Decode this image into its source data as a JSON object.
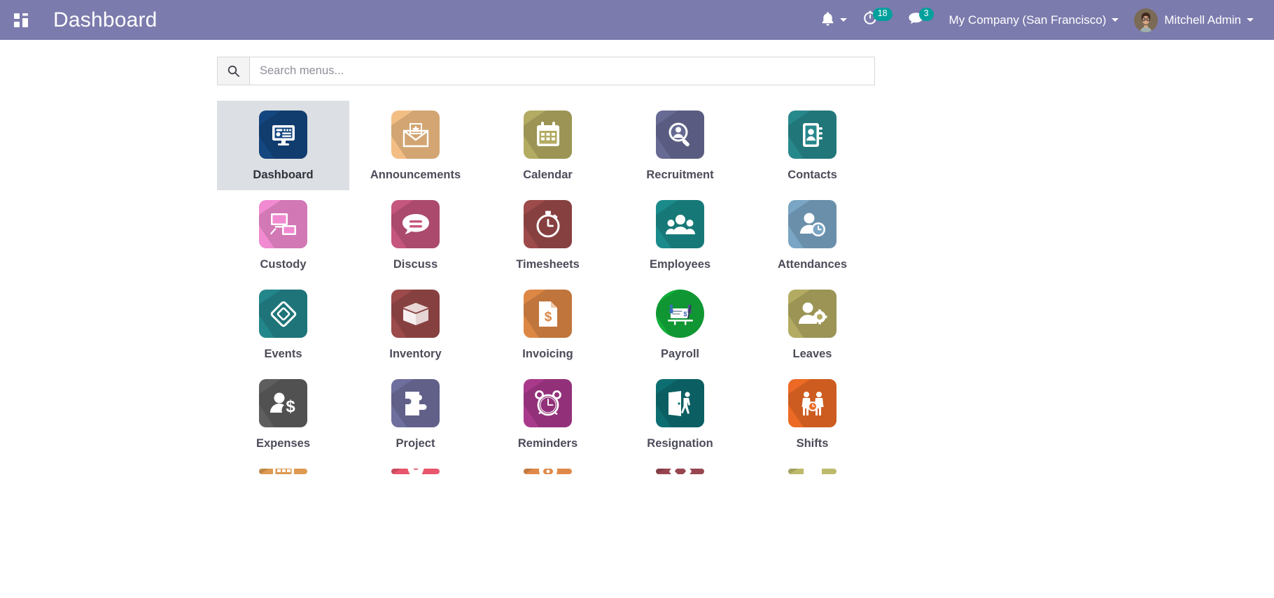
{
  "navbar": {
    "apps_icon": "apps-grid-icon",
    "title": "Dashboard",
    "activities_icon": "bell-icon",
    "timer_icon": "timer-clock-icon",
    "timer_count": "18",
    "messages_icon": "chat-bubble-icon",
    "messages_count": "3",
    "company": "My Company (San Francisco)",
    "user": "Mitchell Admin",
    "accent": "#7c7bad",
    "badge_color": "#00a09d"
  },
  "search": {
    "icon": "search-icon",
    "placeholder": "Search menus...",
    "value": ""
  },
  "apps": {
    "rows": [
      [
        {
          "label": "Dashboard",
          "icon": "monitor-dashboard-icon",
          "color": "#14467f",
          "selected": true
        },
        {
          "label": "Announcements",
          "icon": "envelope-star-icon",
          "color": "#f2be84",
          "selected": false
        },
        {
          "label": "Calendar",
          "icon": "calendar-icon",
          "color": "#b3ab62",
          "selected": false
        },
        {
          "label": "Recruitment",
          "icon": "magnifier-person-icon",
          "color": "#676a93",
          "selected": false
        },
        {
          "label": "Contacts",
          "icon": "address-book-icon",
          "color": "#27888c",
          "selected": false
        }
      ],
      [
        {
          "label": "Custody",
          "icon": "devices-icon",
          "color": "#f18ad0",
          "selected": false
        },
        {
          "label": "Discuss",
          "icon": "speech-bubble-icon",
          "color": "#c5567e",
          "selected": false
        },
        {
          "label": "Timesheets",
          "icon": "stopwatch-icon",
          "color": "#9c4a4a",
          "selected": false
        },
        {
          "label": "Employees",
          "icon": "people-group-icon",
          "color": "#1b8a8a",
          "selected": false
        },
        {
          "label": "Attendances",
          "icon": "person-clock-icon",
          "color": "#7aa5c4",
          "selected": false
        }
      ],
      [
        {
          "label": "Events",
          "icon": "diamond-icon",
          "color": "#23868a",
          "selected": false
        },
        {
          "label": "Inventory",
          "icon": "box-icon",
          "color": "#9c4a4a",
          "selected": false
        },
        {
          "label": "Invoicing",
          "icon": "invoice-doc-icon",
          "color": "#dd8745",
          "selected": false
        },
        {
          "label": "Payroll",
          "icon": "paycheck-icon",
          "color": "#13ad3a",
          "selected": false,
          "circle": true
        },
        {
          "label": "Leaves",
          "icon": "person-gear-icon",
          "color": "#b3ab62",
          "selected": false
        }
      ],
      [
        {
          "label": "Expenses",
          "icon": "person-dollar-icon",
          "color": "#5e5e5e",
          "selected": false
        },
        {
          "label": "Project",
          "icon": "puzzle-piece-icon",
          "color": "#6f6f9e",
          "selected": false
        },
        {
          "label": "Reminders",
          "icon": "alarm-clock-icon",
          "color": "#a8398b",
          "selected": false
        },
        {
          "label": "Resignation",
          "icon": "door-exit-icon",
          "color": "#0d6e71",
          "selected": false
        },
        {
          "label": "Shifts",
          "icon": "two-people-icon",
          "color": "#ec6a25",
          "selected": false
        }
      ],
      [
        {
          "label": "",
          "icon": "calendar-orange-icon",
          "color": "#dd9a52",
          "selected": false
        },
        {
          "label": "",
          "icon": "pin-pink-icon",
          "color": "#e8566d",
          "selected": false
        },
        {
          "label": "",
          "icon": "orange-app-icon",
          "color": "#e08a4a",
          "selected": false
        },
        {
          "label": "",
          "icon": "maroon-app-icon",
          "color": "#974650",
          "selected": false
        },
        {
          "label": "",
          "icon": "olive-app-icon",
          "color": "#bdba6b",
          "selected": false
        }
      ]
    ]
  }
}
